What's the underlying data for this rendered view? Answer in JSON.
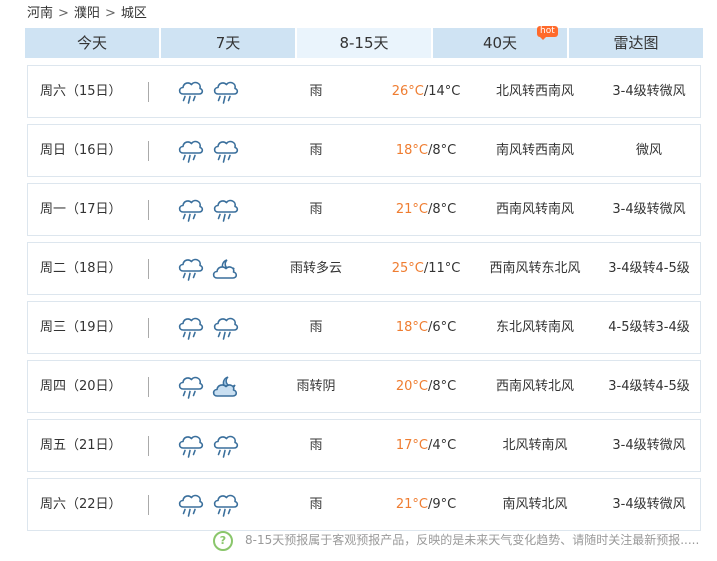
{
  "breadcrumb": [
    "河南",
    "濮阳",
    "城区"
  ],
  "tabs": [
    {
      "label": "今天"
    },
    {
      "label": "7天"
    },
    {
      "label": "8-15天",
      "active": true
    },
    {
      "label": "40天",
      "badge": "hot"
    },
    {
      "label": "雷达图"
    }
  ],
  "days": [
    {
      "day": "周六（15日）",
      "icons": [
        "rain-icon",
        "rain-icon"
      ],
      "condition": "雨",
      "high": "26°C",
      "low": "/14°C",
      "wind": "北风转西南风",
      "level": "3-4级转微风"
    },
    {
      "day": "周日（16日）",
      "icons": [
        "rain-icon",
        "rain-icon"
      ],
      "condition": "雨",
      "high": "18°C",
      "low": "/8°C",
      "wind": "南风转西南风",
      "level": "微风"
    },
    {
      "day": "周一（17日）",
      "icons": [
        "rain-icon",
        "rain-icon"
      ],
      "condition": "雨",
      "high": "21°C",
      "low": "/8°C",
      "wind": "西南风转南风",
      "level": "3-4级转微风"
    },
    {
      "day": "周二（18日）",
      "icons": [
        "rain-icon",
        "cloudy-night-icon"
      ],
      "condition": "雨转多云",
      "high": "25°C",
      "low": "/11°C",
      "wind": "西南风转东北风",
      "level": "3-4级转4-5级"
    },
    {
      "day": "周三（19日）",
      "icons": [
        "rain-icon",
        "rain-icon"
      ],
      "condition": "雨",
      "high": "18°C",
      "low": "/6°C",
      "wind": "东北风转南风",
      "level": "4-5级转3-4级"
    },
    {
      "day": "周四（20日）",
      "icons": [
        "rain-icon",
        "overcast-night-icon"
      ],
      "condition": "雨转阴",
      "high": "20°C",
      "low": "/8°C",
      "wind": "西南风转北风",
      "level": "3-4级转4-5级"
    },
    {
      "day": "周五（21日）",
      "icons": [
        "rain-icon",
        "rain-icon"
      ],
      "condition": "雨",
      "high": "17°C",
      "low": "/4°C",
      "wind": "北风转南风",
      "level": "3-4级转微风"
    },
    {
      "day": "周六（22日）",
      "icons": [
        "rain-icon",
        "rain-icon"
      ],
      "condition": "雨",
      "high": "21°C",
      "low": "/9°C",
      "wind": "南风转北风",
      "level": "3-4级转微风"
    }
  ],
  "note": {
    "icon": "?",
    "text": "8-15天预报属于客观预报产品，反映的是未来天气变化趋势、请随时关注最新预报....."
  },
  "colors": {
    "accent_high": "#ef7d31",
    "tab_bg": "#cfe3f3",
    "tab_active_bg": "#eaf4fc",
    "hot_badge": "#ff6a2b"
  }
}
